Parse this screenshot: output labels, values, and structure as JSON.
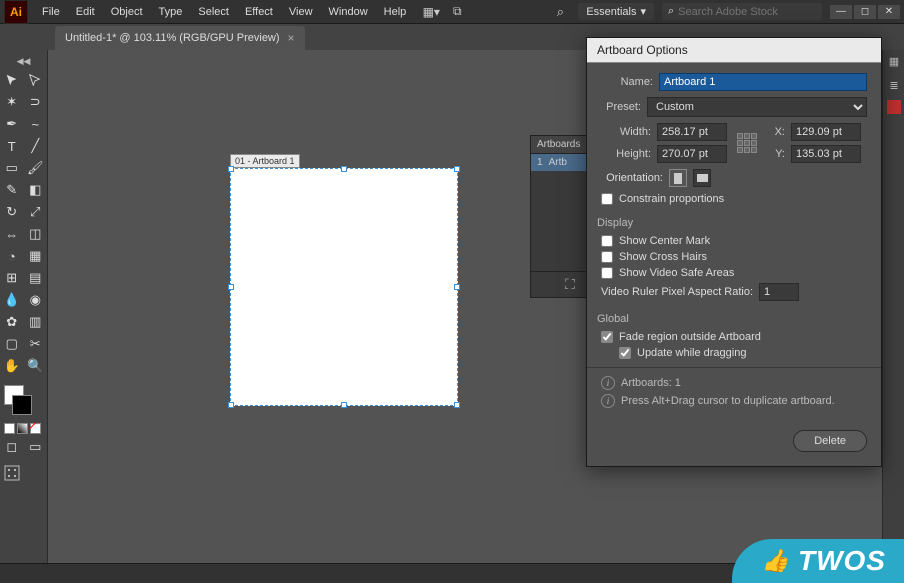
{
  "menubar": {
    "items": [
      "File",
      "Edit",
      "Object",
      "Type",
      "Select",
      "Effect",
      "View",
      "Window",
      "Help"
    ],
    "workspace_label": "Essentials",
    "search_placeholder": "Search Adobe Stock"
  },
  "document_tab": {
    "title": "Untitled-1* @ 103.11% (RGB/GPU Preview)"
  },
  "artboard": {
    "label": "01 - Artboard 1"
  },
  "artboards_panel": {
    "tab": "Artboards",
    "row_index": "1",
    "row_name": "Artb"
  },
  "dialog": {
    "title": "Artboard Options",
    "name_label": "Name:",
    "name_value": "Artboard 1",
    "preset_label": "Preset:",
    "preset_value": "Custom",
    "width_label": "Width:",
    "width_value": "258.17 pt",
    "height_label": "Height:",
    "height_value": "270.07 pt",
    "x_label": "X:",
    "x_value": "129.09 pt",
    "y_label": "Y:",
    "y_value": "135.03 pt",
    "orientation_label": "Orientation:",
    "constrain_label": "Constrain proportions",
    "constrain_checked": false,
    "display_title": "Display",
    "show_center_label": "Show Center Mark",
    "show_center_checked": false,
    "show_cross_label": "Show Cross Hairs",
    "show_cross_checked": false,
    "show_safe_label": "Show Video Safe Areas",
    "show_safe_checked": false,
    "ratio_label": "Video Ruler Pixel Aspect Ratio:",
    "ratio_value": "1",
    "global_title": "Global",
    "fade_label": "Fade region outside Artboard",
    "fade_checked": true,
    "update_label": "Update while dragging",
    "update_checked": true,
    "info_count": "Artboards: 1",
    "info_tip": "Press Alt+Drag cursor to duplicate artboard.",
    "delete_label": "Delete"
  },
  "badge": {
    "text": "TWOS"
  }
}
